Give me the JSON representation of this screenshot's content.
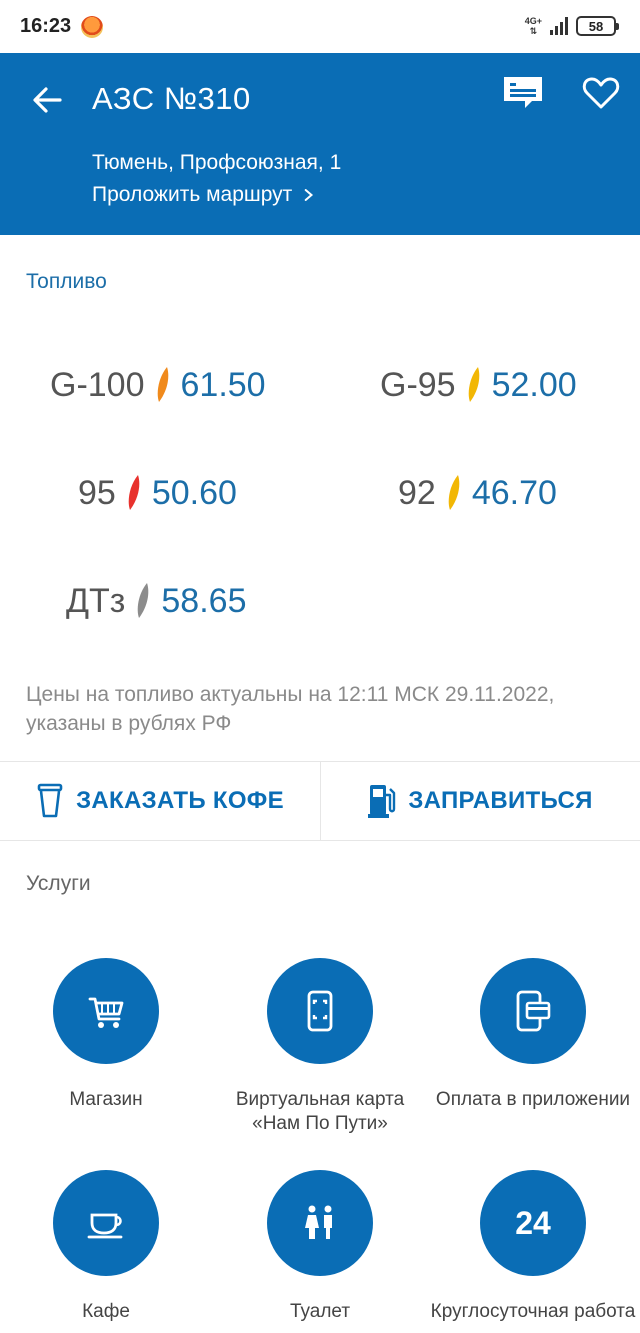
{
  "status": {
    "time": "16:23",
    "network": "4G+",
    "battery": "58"
  },
  "header": {
    "title": "АЗС №310",
    "address": "Тюмень, Профсоюзная, 1",
    "route_label": "Проложить маршрут"
  },
  "fuel": {
    "section_title": "Топливо",
    "items": [
      {
        "name": "G-100",
        "price": "61.50",
        "color": "#f08a1c"
      },
      {
        "name": "G-95",
        "price": "52.00",
        "color": "#f2b705"
      },
      {
        "name": "95",
        "price": "50.60",
        "color": "#e8322d"
      },
      {
        "name": "92",
        "price": "46.70",
        "color": "#f2b705"
      },
      {
        "name": "ДТз",
        "price": "58.65",
        "color": "#8c8c8c"
      }
    ],
    "note": "Цены на топливо актуальны на 12:11 МСК 29.11.2022, указаны в рублях РФ"
  },
  "actions": {
    "coffee_label": "ЗАКАЗАТЬ КОФЕ",
    "refuel_label": "ЗАПРАВИТЬСЯ"
  },
  "services": {
    "section_title": "Услуги",
    "items": [
      {
        "label": "Магазин",
        "icon": "cart-icon"
      },
      {
        "label": "Виртуальная карта «Нам По Пути»",
        "icon": "phone-card-icon"
      },
      {
        "label": "Оплата в приложении",
        "icon": "phone-payment-icon"
      },
      {
        "label": "Кафе",
        "icon": "coffee-cup-icon"
      },
      {
        "label": "Туалет",
        "icon": "toilet-icon"
      },
      {
        "label": "Круглосуточная работа",
        "icon": "clock-24-icon",
        "badge": "24"
      }
    ]
  },
  "colors": {
    "brand": "#0a6db5",
    "price": "#1c6ea8"
  }
}
